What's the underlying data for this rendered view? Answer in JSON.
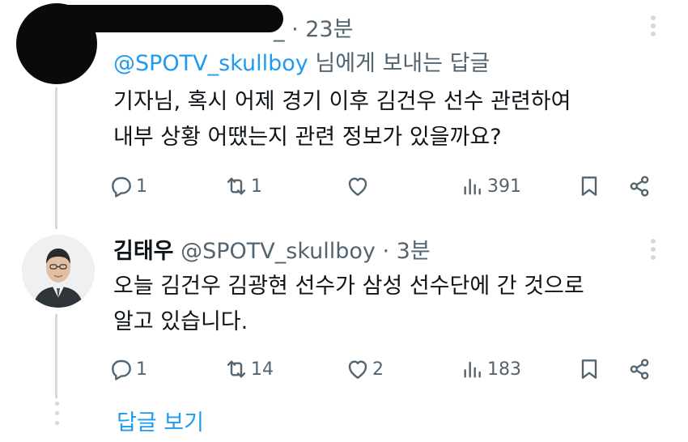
{
  "tweet1": {
    "name_suffix": "_",
    "time": "· 23분",
    "reply_to_handle": "@SPOTV_skullboy",
    "reply_to_suffix": "님에게 보내는 답글",
    "lines": [
      "기자님, 혹시 어제 경기 이후 김건우 선수 관련하여",
      "내부 상황 어땠는지 관련 정보가 있을까요?"
    ],
    "replies": "1",
    "retweets": "1",
    "likes": "",
    "views": "391"
  },
  "tweet2": {
    "name": "김태우",
    "handle": "@SPOTV_skullboy",
    "time": "· 3분",
    "lines": [
      "오늘 김건우 김광현 선수가 삼성 선수단에 간 것으로",
      "알고 있습니다."
    ],
    "replies": "1",
    "retweets": "14",
    "likes": "2",
    "views": "183"
  },
  "show_replies_label": "답글 보기",
  "colors": {
    "accent": "#1d9bf0",
    "text": "#0f1419",
    "secondary": "#536471",
    "line": "#cfd9de"
  },
  "icons": [
    "reply-icon",
    "retweet-icon",
    "like-icon",
    "views-icon",
    "bookmark-icon",
    "share-icon",
    "more-icon"
  ]
}
